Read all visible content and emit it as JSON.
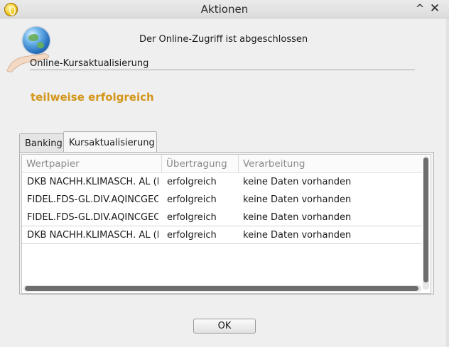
{
  "window": {
    "title": "Aktionen",
    "shade_glyph": "^",
    "close_glyph": "✕"
  },
  "header": {
    "status_text": "Der Online-Zugriff ist abgeschlossen"
  },
  "section": {
    "label": "Online-Kursaktualisierung"
  },
  "result": {
    "text": "teilweise erfolgreich",
    "color": "#d3961b"
  },
  "tabs": [
    {
      "label": "Banking",
      "active": false
    },
    {
      "label": "Kursaktualisierung",
      "active": true
    }
  ],
  "table": {
    "columns": [
      "Wertpapier",
      "Übertragung",
      "Verarbeitung"
    ],
    "rows": [
      [
        "DKB NACHH.KLIMASCH. AL (hi",
        "erfolgreich",
        "keine Daten vorhanden"
      ],
      [
        "FIDEL.FDS-GL.DIV.AQINCGEO",
        "erfolgreich",
        "keine Daten vorhanden"
      ],
      [
        "FIDEL.FDS-GL.DIV.AQINCGEO",
        "erfolgreich",
        "keine Daten vorhanden"
      ],
      [
        "DKB NACHH.KLIMASCH. AL (hi",
        "erfolgreich",
        "keine Daten vorhanden"
      ]
    ]
  },
  "buttons": {
    "ok_label": "OK"
  }
}
